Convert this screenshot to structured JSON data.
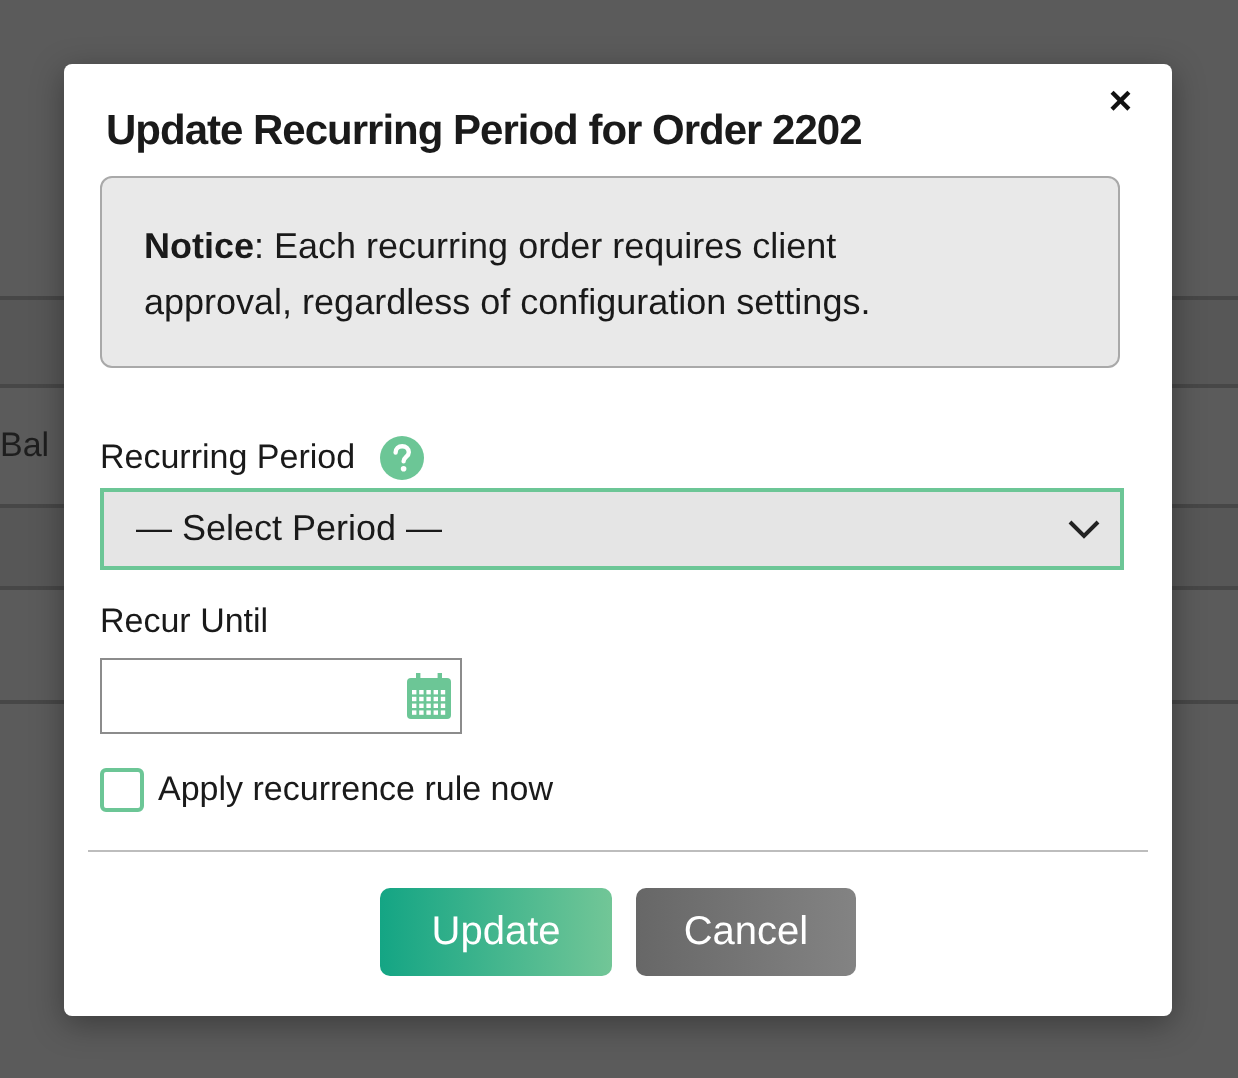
{
  "background": {
    "row_text": "Bal"
  },
  "dialog": {
    "title": "Update Recurring Period for Order 2202",
    "close": "×",
    "notice": "**Notice**: Each recurring order requires client approval, regardless of configuration settings.",
    "period": {
      "label": "Recurring Period",
      "value": "— Select Period —",
      "focused": true
    },
    "recur_until": {
      "label": "Recur Until"
    },
    "apply_now": {
      "label": "Apply recurrence rule now",
      "checked": false
    },
    "buttons": [
      {
        "label": "Update",
        "kind": "primary"
      },
      {
        "label": "Cancel",
        "kind": "secondary"
      }
    ]
  }
}
